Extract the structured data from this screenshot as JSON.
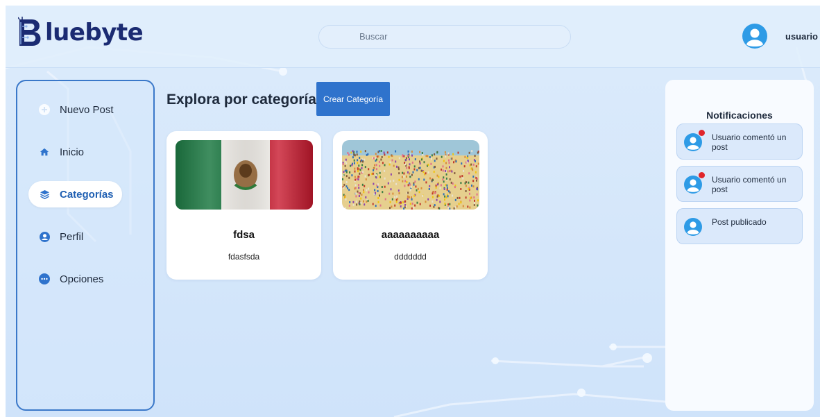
{
  "brand": {
    "name": "luebyte",
    "initial": "B",
    "color": "#1b2b72"
  },
  "search": {
    "placeholder": "Buscar"
  },
  "user": {
    "name": "usuario",
    "avatar_icon": "user-avatar-icon"
  },
  "sidebar": {
    "items": [
      {
        "label": "Nuevo Post",
        "icon": "plus-circle-icon",
        "active": false
      },
      {
        "label": "Inicio",
        "icon": "home-icon",
        "active": false
      },
      {
        "label": "Categorías",
        "icon": "layers-icon",
        "active": true
      },
      {
        "label": "Perfil",
        "icon": "user-circle-icon",
        "active": false
      },
      {
        "label": "Opciones",
        "icon": "more-circle-icon",
        "active": false
      }
    ]
  },
  "main": {
    "title": "Explora por categoría",
    "create_button": "Crear Categoría",
    "categories": [
      {
        "title": "fdsa",
        "description": "fdasfsda",
        "image": "mexico-flag-image"
      },
      {
        "title": "aaaaaaaaaa",
        "description": "ddddddd",
        "image": "crowd-beach-image"
      }
    ]
  },
  "notifications": {
    "title": "Notificaciones",
    "items": [
      {
        "text": "Usuario comentó un post",
        "unread": true
      },
      {
        "text": "Usuario comentó un post",
        "unread": true
      },
      {
        "text": "Post publicado",
        "unread": false
      }
    ]
  },
  "colors": {
    "accent": "#2f73cc",
    "sidebar_border": "#3a78c9",
    "unread_dot": "#e0252b",
    "background": "#d6e8fb"
  }
}
